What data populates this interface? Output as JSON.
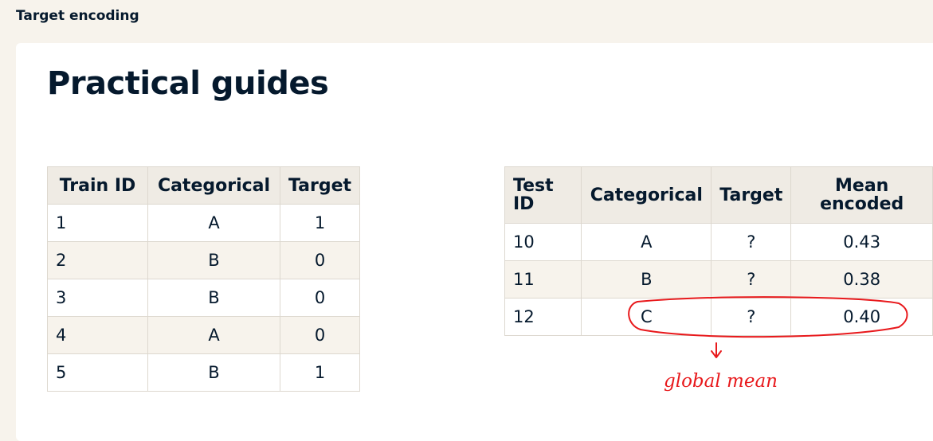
{
  "topbar": {
    "title": "Target encoding"
  },
  "page": {
    "title": "Practical guides"
  },
  "train_table": {
    "headers": [
      "Train ID",
      "Categorical",
      "Target"
    ],
    "rows": [
      [
        "1",
        "A",
        "1"
      ],
      [
        "2",
        "B",
        "0"
      ],
      [
        "3",
        "B",
        "0"
      ],
      [
        "4",
        "A",
        "0"
      ],
      [
        "5",
        "B",
        "1"
      ]
    ]
  },
  "test_table": {
    "headers": [
      "Test ID",
      "Categorical",
      "Target",
      "Mean encoded"
    ],
    "rows": [
      [
        "10",
        "A",
        "?",
        "0.43"
      ],
      [
        "11",
        "B",
        "?",
        "0.38"
      ],
      [
        "12",
        "C",
        "?",
        "0.40"
      ]
    ]
  },
  "annotation": {
    "note": "global mean",
    "color": "#e8191c"
  }
}
